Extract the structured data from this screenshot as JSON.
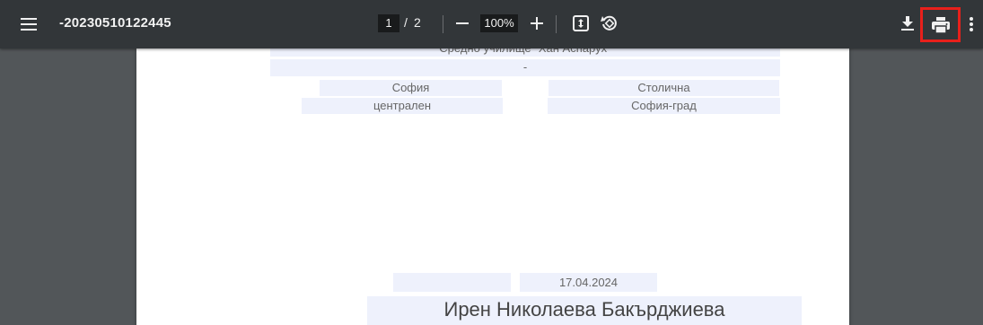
{
  "toolbar": {
    "title": "-20230510122445",
    "current_page": "1",
    "page_separator": "/",
    "total_pages": "2",
    "zoom": "100%",
    "icons": {
      "menu": "hamburger-menu-icon",
      "zoom_out": "minus-icon",
      "zoom_in": "plus-icon",
      "fit": "fit-to-page-icon",
      "rotate": "rotate-icon",
      "download": "download-icon",
      "print": "print-icon",
      "more": "more-vertical-icon"
    },
    "highlight_color": "#e8201b"
  },
  "document": {
    "school_name": "Средно училище \"Хан Аспарух\"",
    "dash_field": "-",
    "city": "София",
    "municipality": "Столична",
    "district": "централен",
    "region": "София-град",
    "empty_field": "",
    "date": "17.04.2024",
    "person_name": "Ирен Николаева Бакърджиева"
  },
  "colors": {
    "toolbar_bg": "#323639",
    "viewer_bg": "#525659",
    "field_bg": "#eef1fc"
  }
}
